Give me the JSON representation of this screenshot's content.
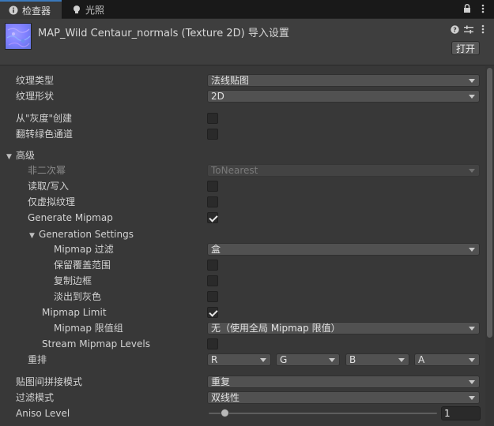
{
  "tabs": [
    {
      "label": "检查器",
      "icon": "info-icon"
    },
    {
      "label": "光照",
      "icon": "lightbulb-icon"
    }
  ],
  "header": {
    "title": "MAP_Wild Centaur_normals (Texture 2D) 导入设置",
    "open_label": "打开"
  },
  "fields": {
    "texture_type": {
      "label": "纹理类型",
      "value": "法线贴图"
    },
    "texture_shape": {
      "label": "纹理形状",
      "value": "2D"
    },
    "create_from_grayscale": {
      "label": "从\"灰度\"创建",
      "checked": false
    },
    "flip_green": {
      "label": "翻转绿色通道",
      "checked": false
    },
    "advanced": {
      "label": "高级"
    },
    "non_power_of_two": {
      "label": "非二次幂",
      "value": "ToNearest"
    },
    "read_write": {
      "label": "读取/写入",
      "checked": false
    },
    "virtual_texture_only": {
      "label": "仅虚拟纹理",
      "checked": false
    },
    "generate_mipmap": {
      "label": "Generate Mipmap",
      "checked": true
    },
    "generation_settings": {
      "label": "Generation Settings"
    },
    "mipmap_filter": {
      "label": "Mipmap 过滤",
      "value": "盒"
    },
    "preserve_coverage": {
      "label": "保留覆盖范围",
      "checked": false
    },
    "replicate_border": {
      "label": "复制边框",
      "checked": false
    },
    "fadeout_to_gray": {
      "label": "淡出到灰色",
      "checked": false
    },
    "mipmap_limit": {
      "label": "Mipmap Limit",
      "checked": true
    },
    "mipmap_limit_group": {
      "label": "Mipmap 限值组",
      "value": "无（使用全局 Mipmap 限值）"
    },
    "stream_mipmap_levels": {
      "label": "Stream Mipmap Levels",
      "checked": false
    },
    "swizzle": {
      "label": "重排",
      "r": "R",
      "g": "G",
      "b": "B",
      "a": "A"
    },
    "wrap_mode": {
      "label": "贴图间拼接模式",
      "value": "重复"
    },
    "filter_mode": {
      "label": "过滤模式",
      "value": "双线性"
    },
    "aniso_level": {
      "label": "Aniso Level",
      "value": "1",
      "slider_fraction": 0.06
    }
  },
  "colors": {
    "background": "#383838",
    "tab_accent": "#3a79bb",
    "normal_map_thumb": "#7f7fff"
  }
}
